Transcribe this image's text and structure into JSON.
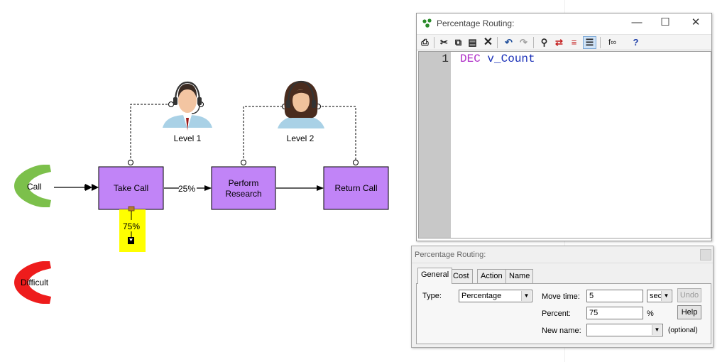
{
  "canvas": {
    "start_call": {
      "label": "Call",
      "color": "#7cc04b"
    },
    "difficult_call": {
      "label": "Difficult",
      "color": "#ee1c1c"
    },
    "take_call": {
      "label": "Take Call"
    },
    "perform_research": {
      "line1": "Perform",
      "line2": "Research"
    },
    "return_call": {
      "label": "Return Call"
    },
    "routing_upper_percent": "25%",
    "routing_lower_percent": "75%",
    "level1": {
      "label": "Level 1"
    },
    "level2": {
      "label": "Level 2"
    },
    "activity_fill": "#c184f7",
    "highlight_fill": "#ffff00"
  },
  "editor": {
    "title": "Percentage Routing:",
    "toolbar_icons": [
      "print-icon",
      "cut-icon",
      "copy-icon",
      "paste-icon",
      "delete-icon",
      "undo-icon",
      "redo-icon",
      "find-icon",
      "replace-icon",
      "goto-icon",
      "format-icon",
      "function-icon",
      "help-icon"
    ],
    "lines": [
      {
        "number": "1",
        "keyword": "DEC",
        "identifier": "v_Count"
      }
    ]
  },
  "properties": {
    "title": "Percentage Routing:",
    "tabs": [
      "General",
      "Cost",
      "Action",
      "Name"
    ],
    "active_tab": "General",
    "type_label": "Type:",
    "type_value": "Percentage",
    "move_time_label": "Move time:",
    "move_time_value": "5",
    "move_time_unit": "sec",
    "percent_label": "Percent:",
    "percent_value": "75",
    "percent_symbol": "%",
    "new_name_label": "New name:",
    "new_name_value": "",
    "optional_note": "(optional)",
    "undo_label": "Undo",
    "help_label": "Help"
  }
}
